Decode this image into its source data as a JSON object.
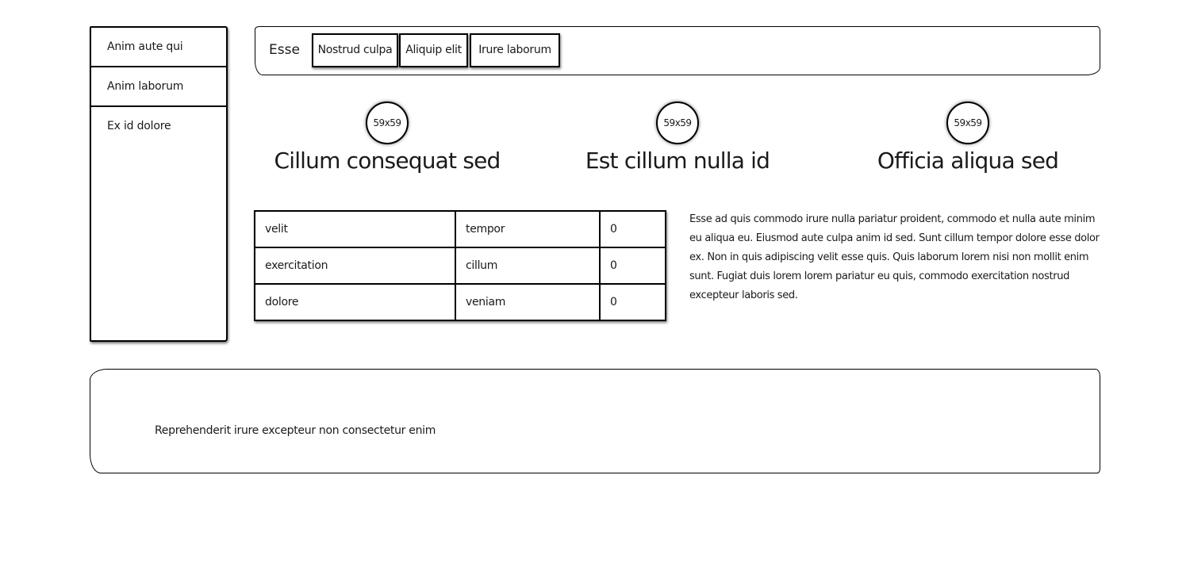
{
  "sidebar": {
    "items": [
      {
        "label": "Anim aute qui"
      },
      {
        "label": "Anim laborum"
      },
      {
        "label": "Ex id dolore"
      }
    ]
  },
  "header": {
    "brand": "Esse",
    "tabs": [
      {
        "label": "Nostrud culpa"
      },
      {
        "label": "Aliquip elit"
      },
      {
        "label": "Irure laborum"
      }
    ]
  },
  "features": [
    {
      "avatar": "59x59",
      "title": "Cillum consequat sed"
    },
    {
      "avatar": "59x59",
      "title": "Est cillum nulla id"
    },
    {
      "avatar": "59x59",
      "title": "Officia aliqua sed"
    }
  ],
  "table": {
    "rows": [
      [
        "velit",
        "tempor",
        "0"
      ],
      [
        "exercitation",
        "cillum",
        "0"
      ],
      [
        "dolore",
        "veniam",
        "0"
      ]
    ]
  },
  "paragraph": "Esse ad quis commodo irure nulla pariatur proident, commodo et nulla aute minim eu aliqua eu. Eiusmod aute culpa anim id sed. Sunt cillum tempor dolore esse dolor ex. Non in quis adipiscing velit esse quis. Quis laborum lorem nisi non mollit enim sunt. Fugiat duis lorem lorem pariatur eu quis, commodo exercitation nostrud excepteur laboris sed.",
  "footer": {
    "text": "Reprehenderit irure excepteur non consectetur enim"
  }
}
